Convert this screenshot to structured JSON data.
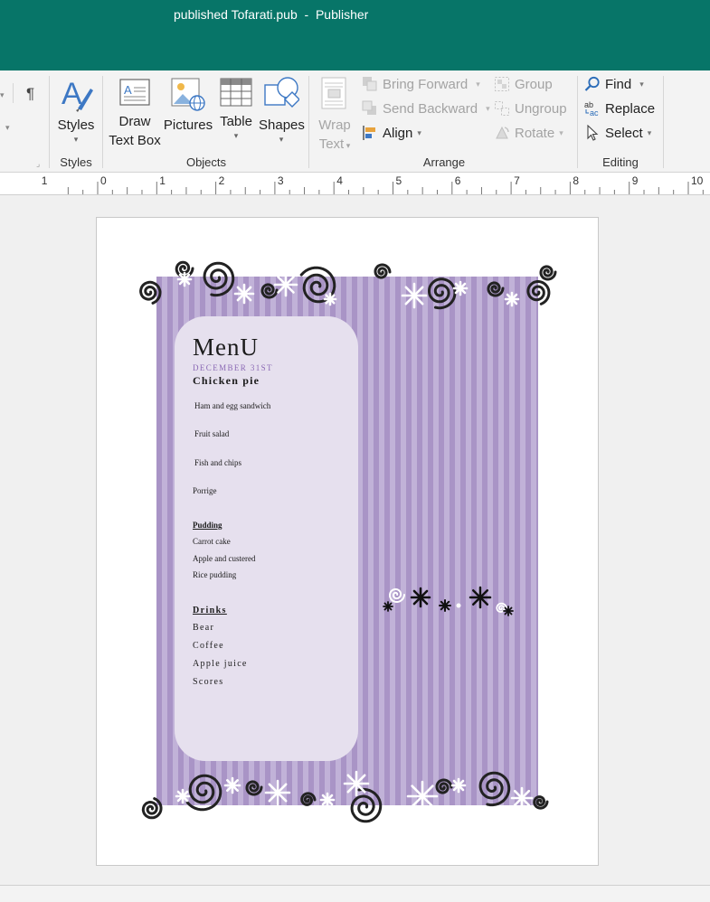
{
  "window": {
    "title": "published Tofarati.pub  -  Publisher"
  },
  "ribbon": {
    "styles_group": {
      "styles_label": "Styles",
      "group_label": "Styles"
    },
    "objects_group": {
      "draw_text_box_line1": "Draw",
      "draw_text_box_line2": "Text Box",
      "pictures_label": "Pictures",
      "table_label": "Table",
      "shapes_label": "Shapes",
      "group_label": "Objects"
    },
    "arrange_group": {
      "wrap_text_line1": "Wrap",
      "wrap_text_line2": "Text",
      "bring_forward_label": "Bring Forward",
      "send_backward_label": "Send Backward",
      "align_label": "Align",
      "group_label_btn": "Group",
      "ungroup_label": "Ungroup",
      "rotate_label": "Rotate",
      "group_label": "Arrange"
    },
    "editing_group": {
      "find_label": "Find",
      "replace_label": "Replace",
      "select_label": "Select",
      "group_label": "Editing"
    },
    "paragraph_mark": "¶"
  },
  "ruler": {
    "numbers": [
      "1",
      "0",
      "1",
      "2",
      "3",
      "4",
      "5",
      "6",
      "7",
      "8",
      "9",
      "10"
    ]
  },
  "document": {
    "menu_title": "MenU",
    "date": "DECEMBER 31ST",
    "main_item": "Chicken pie",
    "items": [
      "Ham and egg sandwich",
      "Fruit salad",
      "Fish and chips",
      "Porrige"
    ],
    "pudding_heading": "Pudding",
    "pudding_items": [
      "Carrot cake",
      "Apple and custered",
      "Rice pudding"
    ],
    "drinks_heading": "Drinks",
    "drinks_items": [
      "Bear",
      "Coffee",
      "Apple juice",
      "Scores"
    ]
  },
  "colors": {
    "titlebar": "#077568",
    "stripe_dark": "#a994c6",
    "stripe_light": "#c1b2d8",
    "panel": "#e6e0ee",
    "date_purple": "#8a68b4",
    "swirl": "#222222"
  },
  "icons": {
    "styles": "styles-icon",
    "draw_text_box": "text-box-icon",
    "pictures": "pictures-icon",
    "table": "table-icon",
    "shapes": "shapes-icon",
    "wrap_text": "wrap-text-icon",
    "find": "magnifier-icon",
    "replace": "replace-icon",
    "select": "cursor-icon"
  }
}
